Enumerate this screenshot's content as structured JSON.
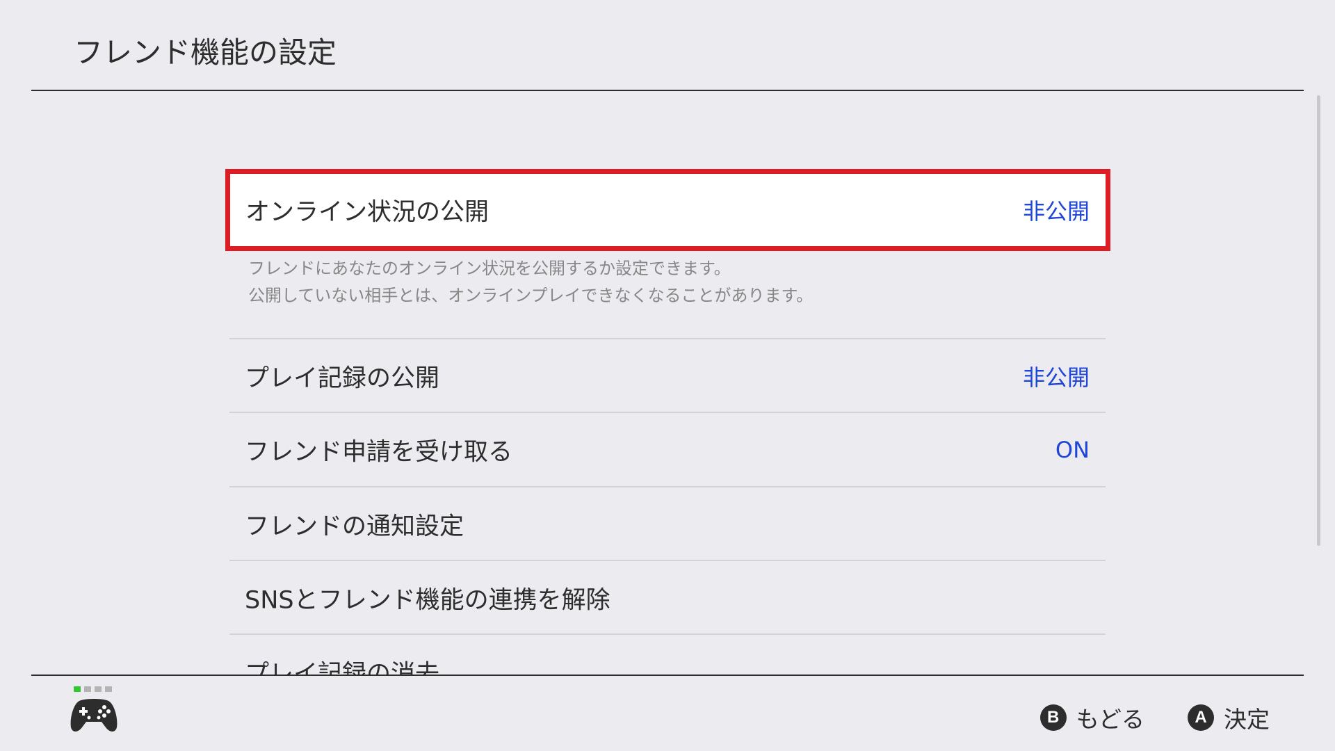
{
  "page": {
    "title": "フレンド機能の設定"
  },
  "settings": {
    "online_status": {
      "label": "オンライン状況の公開",
      "value": "非公開",
      "description_line1": "フレンドにあなたのオンライン状況を公開するか設定できます。",
      "description_line2": "公開していない相手とは、オンラインプレイできなくなることがあります。",
      "selected": true
    },
    "play_activity": {
      "label": "プレイ記録の公開",
      "value": "非公開"
    },
    "friend_requests": {
      "label": "フレンド申請を受け取る",
      "value": "ON"
    },
    "friend_notifications": {
      "label": "フレンドの通知設定"
    },
    "unlink_sns": {
      "label": "SNSとフレンド機能の連携を解除"
    },
    "delete_play_activity": {
      "label": "プレイ記録の消去"
    }
  },
  "footer": {
    "player_indicator": {
      "active_player": 1,
      "total_slots": 4
    },
    "controller_icon": "gamepad-icon",
    "back": {
      "button": "B",
      "label": "もどる"
    },
    "ok": {
      "button": "A",
      "label": "決定"
    }
  },
  "colors": {
    "background": "#ebebf0",
    "selection_border": "#de1c24",
    "value_text": "#1f46d7",
    "player_active": "#31c831"
  }
}
